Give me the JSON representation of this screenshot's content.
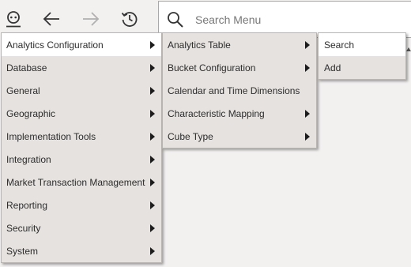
{
  "toolbar": {
    "profile_icon": "user-profile-icon",
    "back_icon": "arrow-left-icon",
    "forward_icon": "arrow-right-icon",
    "history_icon": "history-icon"
  },
  "search": {
    "placeholder": "Search Menu",
    "icon": "search-icon"
  },
  "menu_level1": {
    "items": [
      {
        "label": "Analytics Configuration",
        "has_submenu": true,
        "active": true
      },
      {
        "label": "Database",
        "has_submenu": true
      },
      {
        "label": "General",
        "has_submenu": true
      },
      {
        "label": "Geographic",
        "has_submenu": true
      },
      {
        "label": "Implementation Tools",
        "has_submenu": true
      },
      {
        "label": "Integration",
        "has_submenu": true
      },
      {
        "label": "Market Transaction Management",
        "has_submenu": true
      },
      {
        "label": "Reporting",
        "has_submenu": true
      },
      {
        "label": "Security",
        "has_submenu": true
      },
      {
        "label": "System",
        "has_submenu": true
      }
    ]
  },
  "menu_level2": {
    "items": [
      {
        "label": "Analytics Table",
        "has_submenu": true
      },
      {
        "label": "Bucket Configuration",
        "has_submenu": true
      },
      {
        "label": "Calendar and Time Dimensions",
        "has_submenu": false
      },
      {
        "label": "Characteristic Mapping",
        "has_submenu": true
      },
      {
        "label": "Cube Type",
        "has_submenu": true
      }
    ]
  },
  "menu_level3": {
    "items": [
      {
        "label": "Search",
        "active": true
      },
      {
        "label": "Add"
      }
    ]
  },
  "colors": {
    "background": "#f2f1f0",
    "menu_bg": "#e5e2df",
    "menu_active": "#ffffff",
    "icon": "#333333",
    "icon_disabled": "#b0b0b0"
  }
}
